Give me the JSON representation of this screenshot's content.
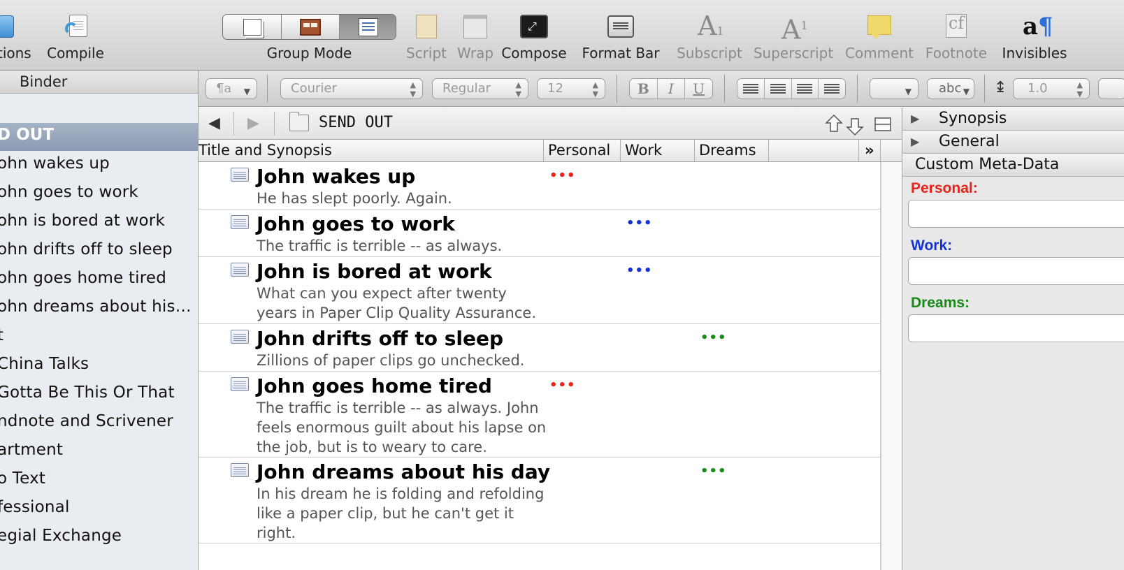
{
  "toolbar": {
    "items": [
      {
        "label": "tions",
        "icon": "options-icon",
        "dim": false
      },
      {
        "label": "Compile",
        "icon": "compile-icon",
        "dim": false
      },
      {
        "label": "Group Mode",
        "icon": "group-mode-icon",
        "dim": false
      },
      {
        "label": "Script",
        "icon": "script-icon",
        "dim": true
      },
      {
        "label": "Wrap",
        "icon": "wrap-icon",
        "dim": true
      },
      {
        "label": "Compose",
        "icon": "compose-icon",
        "dim": false
      },
      {
        "label": "Format Bar",
        "icon": "format-bar-icon",
        "dim": false
      },
      {
        "label": "Subscript",
        "icon": "subscript-icon",
        "dim": true
      },
      {
        "label": "Superscript",
        "icon": "superscript-icon",
        "dim": true
      },
      {
        "label": "Comment",
        "icon": "comment-icon",
        "dim": true
      },
      {
        "label": "Footnote",
        "icon": "footnote-icon",
        "dim": true
      },
      {
        "label": "Invisibles",
        "icon": "invisibles-icon",
        "dim": false
      }
    ],
    "group_mode_selected": "outline",
    "icon_glyphs": {
      "subscript": "A",
      "superscript": "A",
      "footnote": "cf",
      "invisibles": "a",
      "sub_digit": "1"
    }
  },
  "format_bar": {
    "paragraph_style": "¶a",
    "font_family": "Courier",
    "font_style": "Regular",
    "font_size": "12",
    "bold": "B",
    "italic": "I",
    "underline": "U",
    "highlight": "abc",
    "line_spacing": "1.0"
  },
  "binder": {
    "header": "Binder",
    "selected": "D OUT",
    "items": [
      "ohn wakes up",
      "ohn goes to work",
      "ohn is bored at work",
      "ohn drifts off to sleep",
      "ohn goes home tired",
      "ohn dreams about his…",
      "t",
      "China Talks",
      "Gotta Be This Or That",
      "ndnote and Scrivener",
      "artment",
      "o Text",
      "fessional",
      "egial Exchange"
    ]
  },
  "editor": {
    "title": "SEND OUT",
    "back_glyph": "◀",
    "forward_glyph": "▶"
  },
  "outline": {
    "columns": [
      "Title and Synopsis",
      "Personal",
      "Work",
      "Dreams"
    ],
    "more_columns_glyph": "»",
    "rows": [
      {
        "title": "John wakes up",
        "synopsis": "He has slept poorly. Again.",
        "label": "Personal",
        "dots": "•••"
      },
      {
        "title": "John goes to work",
        "synopsis": "The traffic is terrible -- as always.",
        "label": "Work",
        "dots": "•••"
      },
      {
        "title": "John is bored at work",
        "synopsis": "What can you expect after twenty years in Paper Clip Quality Assurance.",
        "label": "Work",
        "dots": "•••"
      },
      {
        "title": "John drifts off to sleep",
        "synopsis": "Zillions of paper clips go unchecked.",
        "label": "Dreams",
        "dots": "•••"
      },
      {
        "title": "John goes home tired",
        "synopsis": "The traffic is terrible -- as always. John feels enormous guilt about his lapse on the job, but is to weary to care.",
        "label": "Personal",
        "dots": "•••"
      },
      {
        "title": "John dreams about his day",
        "synopsis": "In his dream he is folding and refolding like a paper clip, but he can't get it right.",
        "label": "Dreams",
        "dots": "•••"
      }
    ]
  },
  "inspector": {
    "sections": [
      {
        "label": "Synopsis",
        "glyph": "▶"
      },
      {
        "label": "General",
        "glyph": "▶"
      }
    ],
    "custom_meta_header": "Custom Meta-Data",
    "fields": [
      {
        "label": "Personal:",
        "value": ""
      },
      {
        "label": "Work:",
        "value": ""
      },
      {
        "label": "Dreams:",
        "value": ""
      }
    ]
  },
  "colors": {
    "personal": "#e8231a",
    "work": "#1433d6",
    "dreams": "#178a17",
    "binder_selection": "#97a6bd"
  }
}
